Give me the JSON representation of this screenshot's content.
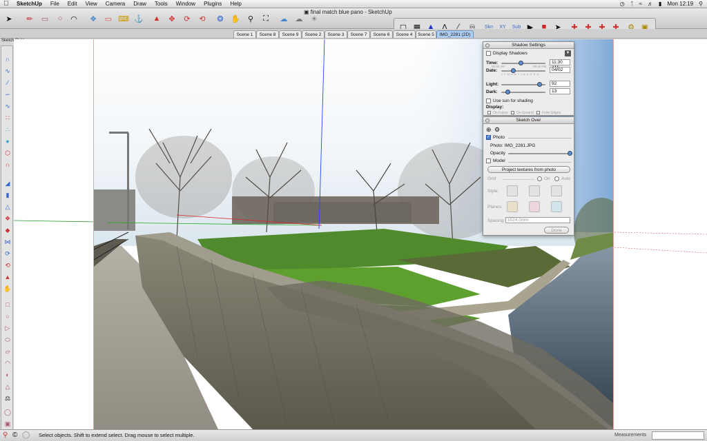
{
  "menubar": {
    "app_name": "SketchUp",
    "items": [
      "File",
      "Edit",
      "View",
      "Camera",
      "Draw",
      "Tools",
      "Window",
      "Plugins",
      "Help"
    ],
    "clock": "Mon 12:19"
  },
  "window": {
    "title": "final match blue pano - SketchUp"
  },
  "doc_label": "Sketch Over",
  "scenes": [
    {
      "label": "Scene 1"
    },
    {
      "label": "Scene 8"
    },
    {
      "label": "Scene 9"
    },
    {
      "label": "Scene 2"
    },
    {
      "label": "Scene 3"
    },
    {
      "label": "Scene 7"
    },
    {
      "label": "Scene 6"
    },
    {
      "label": "Scene 4"
    },
    {
      "label": "Scene 5"
    },
    {
      "label": "IMG_2281 (2D)",
      "active": true
    }
  ],
  "status": {
    "text": "Select objects. Shift to extend select. Drag mouse to select multiple.",
    "measurements_label": "Measurements"
  },
  "shadow": {
    "title": "Shadow Settings",
    "display_label": "Display Shadows",
    "time_label": "Time:",
    "time_start": "05:40 AM",
    "time_end": "06:40 PM",
    "time_value": "11:30 AM",
    "date_label": "Date:",
    "months": "J F M A M J J A S O N D",
    "date_value": "04/02",
    "light_label": "Light:",
    "light_value": "92",
    "dark_label": "Dark:",
    "dark_value": "13",
    "sun_label": "Use sun for shading",
    "display_section": "Display:",
    "on_faces": "On Faces",
    "on_ground": "On Ground",
    "from_edges": "From Edges"
  },
  "sketch": {
    "title": "Sketch Over",
    "photo_label": "Photo",
    "photo_name": "Photo: IMG_2281.JPG",
    "opacity_label": "Opacity",
    "model_label": "Model",
    "project_button": "Project textures from photo",
    "grid_label": "Grid",
    "grid_on": "On",
    "grid_auto": "Auto",
    "style_label": "Style:",
    "planes_label": "Planes:",
    "spacing_label": "Spacing:",
    "spacing_value": "1524.0mm",
    "done_button": "Done"
  }
}
